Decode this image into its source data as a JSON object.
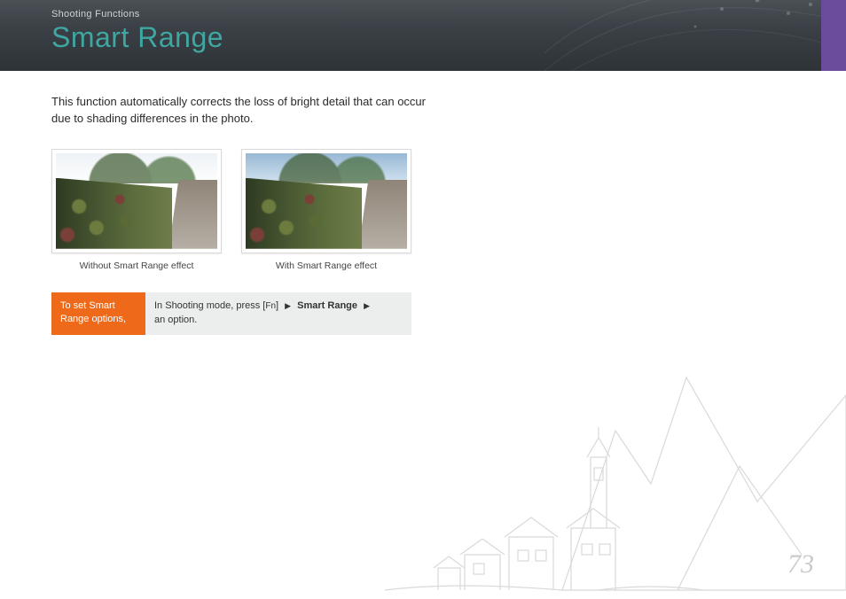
{
  "header": {
    "breadcrumb": "Shooting Functions",
    "title": "Smart Range"
  },
  "intro": "This function automatically corrects the loss of bright detail that can occur due to shading differences in the photo.",
  "images": [
    {
      "caption": "Without Smart Range effect"
    },
    {
      "caption": "With Smart Range effect"
    }
  ],
  "howto": {
    "label": "To set Smart Range options,",
    "prefix": "In Shooting mode, press [",
    "fn": "Fn",
    "mid": "] ",
    "step1": "Smart Range",
    "suffix": " an option."
  },
  "page_number": "73"
}
